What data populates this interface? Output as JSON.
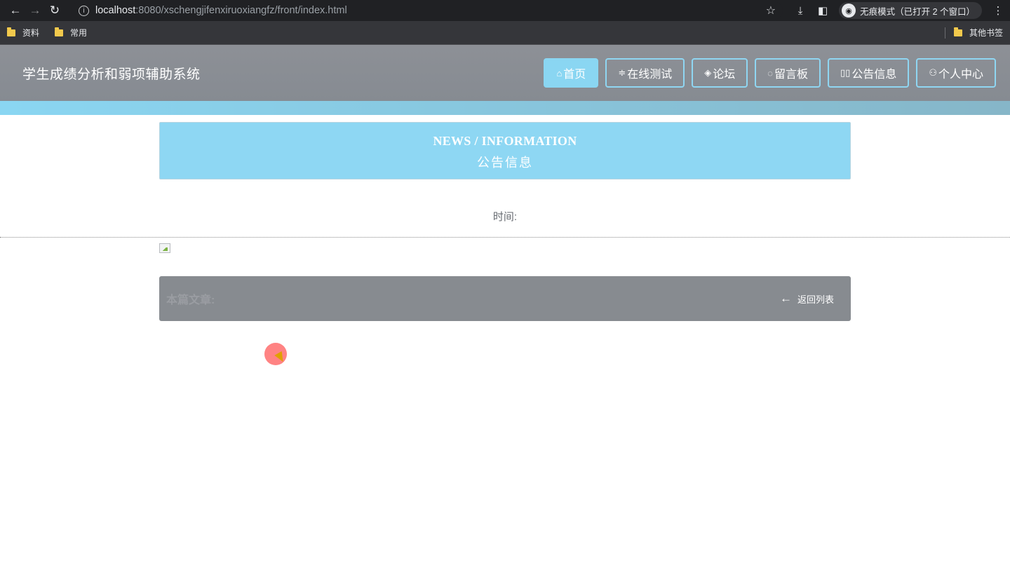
{
  "browser": {
    "url_host": "localhost",
    "url_path": ":8080/xschengjifenxiruoxiangfz/front/index.html",
    "incognito_label": "无痕模式（已打开 2 个窗口）",
    "bookmarks": [
      "资料",
      "常用"
    ],
    "other_bookmarks": "其他书签"
  },
  "site": {
    "title": "学生成绩分析和弱项辅助系统",
    "nav": [
      {
        "icon": "⌂",
        "label": "首页"
      },
      {
        "icon": "≑",
        "label": "在线测试"
      },
      {
        "icon": "◈",
        "label": "论坛"
      },
      {
        "icon": "◌",
        "label": "留言板"
      },
      {
        "icon": "▯▯",
        "label": "公告信息"
      },
      {
        "icon": "⚇",
        "label": "个人中心"
      }
    ]
  },
  "banner": {
    "english": "NEWS / INFORMATION",
    "chinese": "公告信息"
  },
  "article": {
    "time_label": "时间:",
    "this_article_label": "本篇文章:",
    "back_label": "返回列表"
  }
}
